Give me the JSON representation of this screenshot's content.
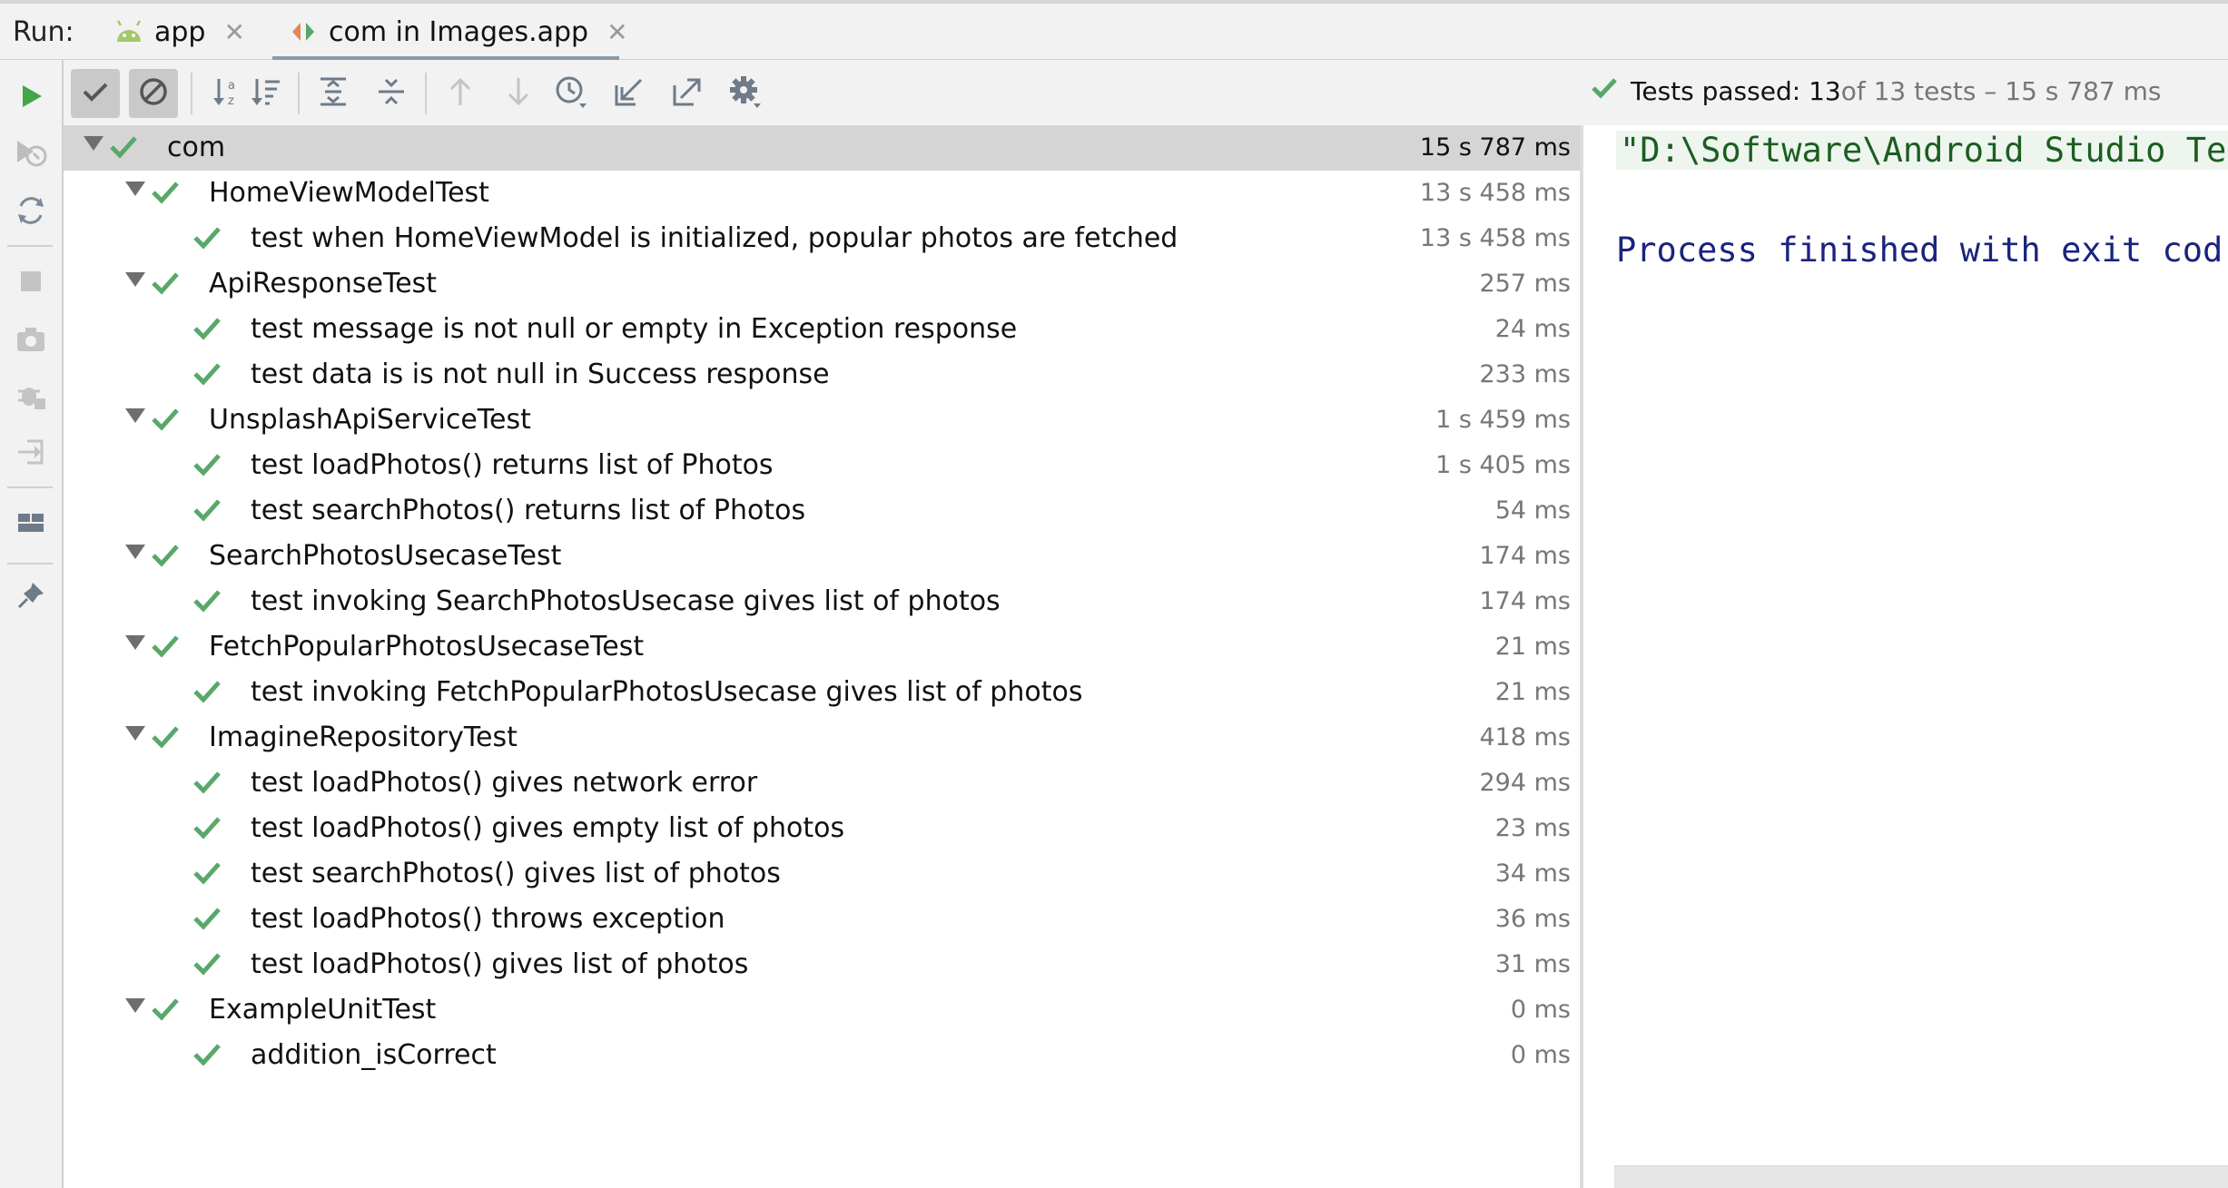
{
  "run_label": "Run:",
  "tabs": [
    {
      "label": "app",
      "icon": "android-icon",
      "close": "✕"
    },
    {
      "label": "com in Images.app",
      "icon": "test-config-icon",
      "close": "✕"
    }
  ],
  "status": {
    "main": "Tests passed: 13",
    "rest": " of 13 tests – 15 s 787 ms"
  },
  "tree": [
    {
      "level": 0,
      "name": "com",
      "time": "15 s 787 ms",
      "expanded": true,
      "selected": true
    },
    {
      "level": 1,
      "name": "HomeViewModelTest",
      "time": "13 s 458 ms",
      "expanded": true
    },
    {
      "level": 2,
      "name": "test when HomeViewModel is initialized, popular photos are fetched",
      "time": "13 s 458 ms"
    },
    {
      "level": 1,
      "name": "ApiResponseTest",
      "time": "257 ms",
      "expanded": true
    },
    {
      "level": 2,
      "name": "test message is not null or empty in Exception response",
      "time": "24 ms"
    },
    {
      "level": 2,
      "name": "test data is is not null in Success response",
      "time": "233 ms"
    },
    {
      "level": 1,
      "name": "UnsplashApiServiceTest",
      "time": "1 s 459 ms",
      "expanded": true
    },
    {
      "level": 2,
      "name": "test loadPhotos() returns list of Photos",
      "time": "1 s 405 ms"
    },
    {
      "level": 2,
      "name": "test searchPhotos() returns list of Photos",
      "time": "54 ms"
    },
    {
      "level": 1,
      "name": "SearchPhotosUsecaseTest",
      "time": "174 ms",
      "expanded": true
    },
    {
      "level": 2,
      "name": "test invoking SearchPhotosUsecase gives list of photos",
      "time": "174 ms"
    },
    {
      "level": 1,
      "name": "FetchPopularPhotosUsecaseTest",
      "time": "21 ms",
      "expanded": true
    },
    {
      "level": 2,
      "name": "test invoking FetchPopularPhotosUsecase gives list of photos",
      "time": "21 ms"
    },
    {
      "level": 1,
      "name": "ImagineRepositoryTest",
      "time": "418 ms",
      "expanded": true
    },
    {
      "level": 2,
      "name": "test loadPhotos() gives network error",
      "time": "294 ms"
    },
    {
      "level": 2,
      "name": "test loadPhotos() gives empty list of photos",
      "time": "23 ms"
    },
    {
      "level": 2,
      "name": "test searchPhotos() gives list of photos",
      "time": "34 ms"
    },
    {
      "level": 2,
      "name": "test loadPhotos() throws exception",
      "time": "36 ms"
    },
    {
      "level": 2,
      "name": "test loadPhotos() gives list of photos",
      "time": "31 ms"
    },
    {
      "level": 1,
      "name": "ExampleUnitTest",
      "time": "0 ms",
      "expanded": true
    },
    {
      "level": 2,
      "name": "addition_isCorrect",
      "time": "0 ms"
    }
  ],
  "console": {
    "command": "\"D:\\Software\\Android Studio Te",
    "finished": "Process finished with exit cod"
  },
  "colors": {
    "pass_green": "#59a869",
    "run_green": "#3fa64a",
    "selected_row": "#d5d5d5",
    "console_cmd": "#1b5e20",
    "console_finish": "#1a237e"
  }
}
